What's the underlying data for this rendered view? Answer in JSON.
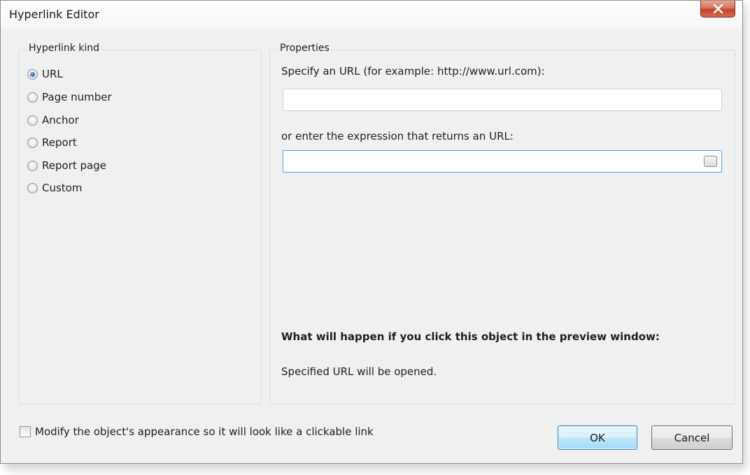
{
  "window": {
    "title": "Hyperlink Editor"
  },
  "kind_group": {
    "label": "Hyperlink kind",
    "options": [
      {
        "label": "URL",
        "checked": true
      },
      {
        "label": "Page number",
        "checked": false
      },
      {
        "label": "Anchor",
        "checked": false
      },
      {
        "label": "Report",
        "checked": false
      },
      {
        "label": "Report page",
        "checked": false
      },
      {
        "label": "Custom",
        "checked": false
      }
    ]
  },
  "properties": {
    "label": "Properties",
    "url_prompt": "Specify an URL (for example: http://www.url.com):",
    "url_value": "",
    "expression_prompt": "or enter the expression that returns an URL:",
    "expression_value": "",
    "result_heading": "What will happen if you click this object in the preview window:",
    "result_text": "Specified URL will be opened."
  },
  "appearance_checkbox": {
    "label": "Modify the object's appearance so it will look like a clickable link",
    "checked": false
  },
  "buttons": {
    "ok": "OK",
    "cancel": "Cancel"
  },
  "icons": {
    "close": "close-icon",
    "ellipsis": "ellipsis-icon"
  },
  "colors": {
    "accent": "#3c7fb1",
    "close_button": "#c2412a",
    "window_bg": "#f0f0f0"
  }
}
